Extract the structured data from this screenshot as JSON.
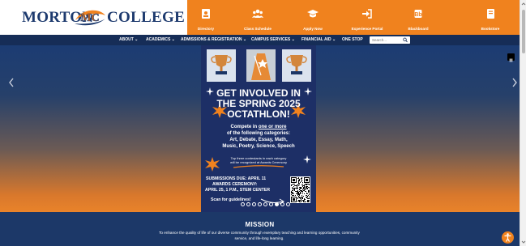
{
  "header": {
    "logo": {
      "word_left": "MORTON",
      "word_right": "COLLEGE",
      "emblem_letters": "MC"
    },
    "quick_links": [
      {
        "label": "Directory",
        "icon": "address-book-icon"
      },
      {
        "label": "Class Schedule",
        "icon": "users-icon"
      },
      {
        "label": "Apply Now",
        "icon": "graduation-cap-icon"
      },
      {
        "label": "Experience Portal",
        "icon": "sign-in-icon"
      },
      {
        "label": "Blackboard",
        "icon": "blackboard-icon"
      },
      {
        "label": "Bookstore",
        "icon": "book-icon"
      }
    ]
  },
  "nav": {
    "items": [
      "ABOUT ⌄",
      "ACADEMICS ⌄",
      "ADMISSIONS & REGISTRATION ⌄",
      "CAMPUS SERVICES ⌄",
      "FINANCIAL AID ⌄",
      "ONE STOP"
    ],
    "search_placeholder": "Search..."
  },
  "slide": {
    "title": [
      "GET INVOLVED IN",
      "THE SPRING 2025",
      "OCTATHLON!"
    ],
    "compete_prefix": "Compete in",
    "compete_emph": "one or more",
    "compete_rest": "of the following categories:",
    "categories_line1": "Art, Debate, Essay, Math,",
    "categories_line2": "Music, Poetry, Science, Speech",
    "top_three_line1": "Top three contestants in each category",
    "top_three_line2": "will be recognized at Awards Ceremony",
    "submissions": "SUBMISSIONS DUE: APRIL 11",
    "awards": "AWARDS CEREMONY:",
    "awards_when": "APRIL 25, 1 P.M., STEM CENTER",
    "scan": "Scan for guidelines!",
    "slide_count": 9,
    "active_slide": 6
  },
  "mission": {
    "title": "MISSION",
    "text_line1": "To enhance the quality of life of our diverse community through exemplary teaching and learning opportunities, community",
    "text_line2": "service, and life-long learning."
  },
  "colors": {
    "brand_blue": "#1d3a6e",
    "brand_orange": "#f0821e",
    "nav_blue": "#162d57"
  }
}
